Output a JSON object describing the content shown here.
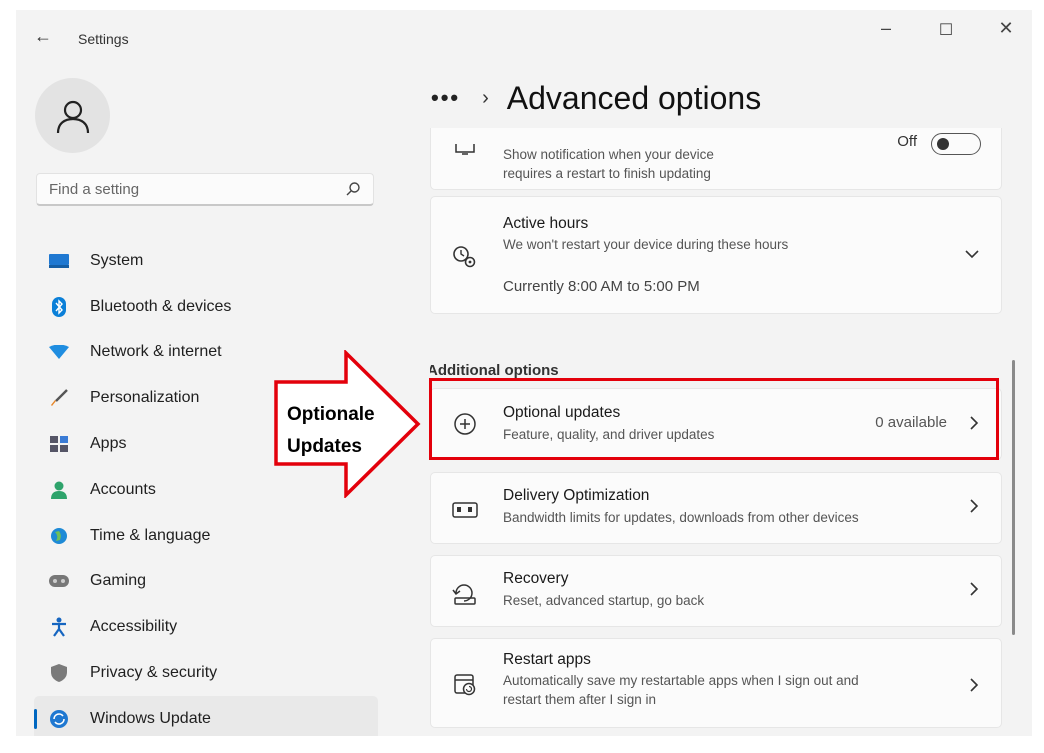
{
  "app": {
    "title": "Settings"
  },
  "window_controls": {
    "minimize": "–",
    "maximize": "☐",
    "close": "✕"
  },
  "search": {
    "placeholder": "Find a setting"
  },
  "nav": {
    "items": [
      {
        "label": "System",
        "icon": "system-icon"
      },
      {
        "label": "Bluetooth & devices",
        "icon": "bluetooth-icon"
      },
      {
        "label": "Network & internet",
        "icon": "network-icon"
      },
      {
        "label": "Personalization",
        "icon": "brush-icon"
      },
      {
        "label": "Apps",
        "icon": "apps-icon"
      },
      {
        "label": "Accounts",
        "icon": "accounts-icon"
      },
      {
        "label": "Time & language",
        "icon": "globe-icon"
      },
      {
        "label": "Gaming",
        "icon": "gamepad-icon"
      },
      {
        "label": "Accessibility",
        "icon": "accessibility-icon"
      },
      {
        "label": "Privacy & security",
        "icon": "shield-icon"
      },
      {
        "label": "Windows Update",
        "icon": "update-icon",
        "active": true
      }
    ]
  },
  "header": {
    "overflow": "•••",
    "separator": "›",
    "title": "Advanced options"
  },
  "cards": {
    "notify": {
      "subtitle_line1": "Show notification when your device",
      "subtitle_line2": "requires a restart to finish updating",
      "toggle_label": "Off"
    },
    "active_hours": {
      "title": "Active hours",
      "subtitle": "We won't restart your device during these hours",
      "value": "Currently 8:00 AM to 5:00 PM"
    },
    "section_title": "Additional options",
    "optional_updates": {
      "title": "Optional updates",
      "subtitle": "Feature, quality, and driver updates",
      "status": "0 available"
    },
    "delivery": {
      "title": "Delivery Optimization",
      "subtitle": "Bandwidth limits for updates, downloads from other devices"
    },
    "recovery": {
      "title": "Recovery",
      "subtitle": "Reset, advanced startup, go back"
    },
    "restart_apps": {
      "title": "Restart apps",
      "subtitle_line1": "Automatically save my restartable apps when I sign out and",
      "subtitle_line2": "restart them after I sign in"
    }
  },
  "annotation": {
    "line1": "Optionale",
    "line2": "Updates",
    "color": "#e3000b"
  }
}
